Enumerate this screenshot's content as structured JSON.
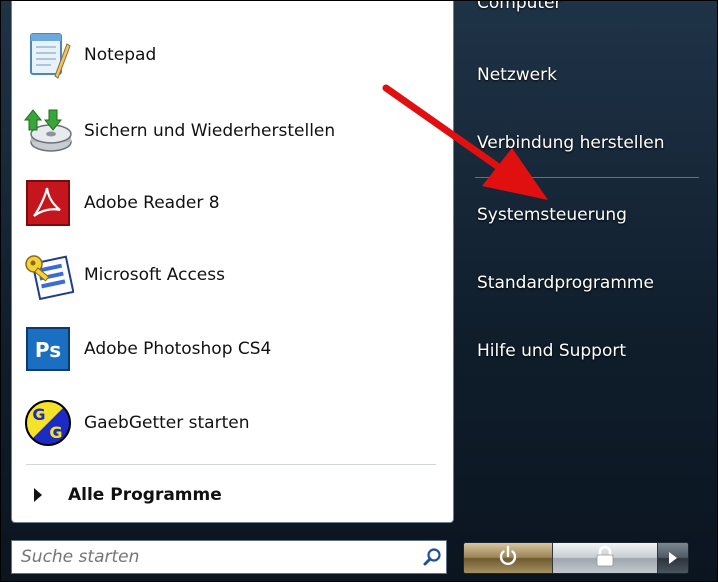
{
  "programs": [
    {
      "label": "Notepad",
      "icon": "notepad-icon"
    },
    {
      "label": "Sichern und Wiederherstellen",
      "icon": "backup-restore-icon"
    },
    {
      "label": "Adobe Reader 8",
      "icon": "adobe-reader-icon"
    },
    {
      "label": "Microsoft Access",
      "icon": "microsoft-access-icon"
    },
    {
      "label": "Adobe Photoshop CS4",
      "icon": "photoshop-icon"
    },
    {
      "label": "GaebGetter starten",
      "icon": "gaebgetter-icon"
    }
  ],
  "all_programs_label": "Alle Programme",
  "search": {
    "placeholder": "Suche starten",
    "icon": "search-icon"
  },
  "right_items": [
    {
      "label": "Computer"
    },
    {
      "label": "Netzwerk"
    },
    {
      "label": "Verbindung herstellen"
    },
    {
      "label": "Systemsteuerung"
    },
    {
      "label": "Standardprogramme"
    },
    {
      "label": "Hilfe und Support"
    }
  ],
  "power_buttons": {
    "power_icon": "power-icon",
    "lock_icon": "lock-icon",
    "more_icon": "arrow-right-icon"
  },
  "photoshop_badge": "Ps",
  "gaeb_letter_top": "G",
  "gaeb_letter_bottom": "G",
  "colors": {
    "arrow": "#e01010",
    "panel": "#ffffff",
    "right_text": "#ffffff"
  }
}
